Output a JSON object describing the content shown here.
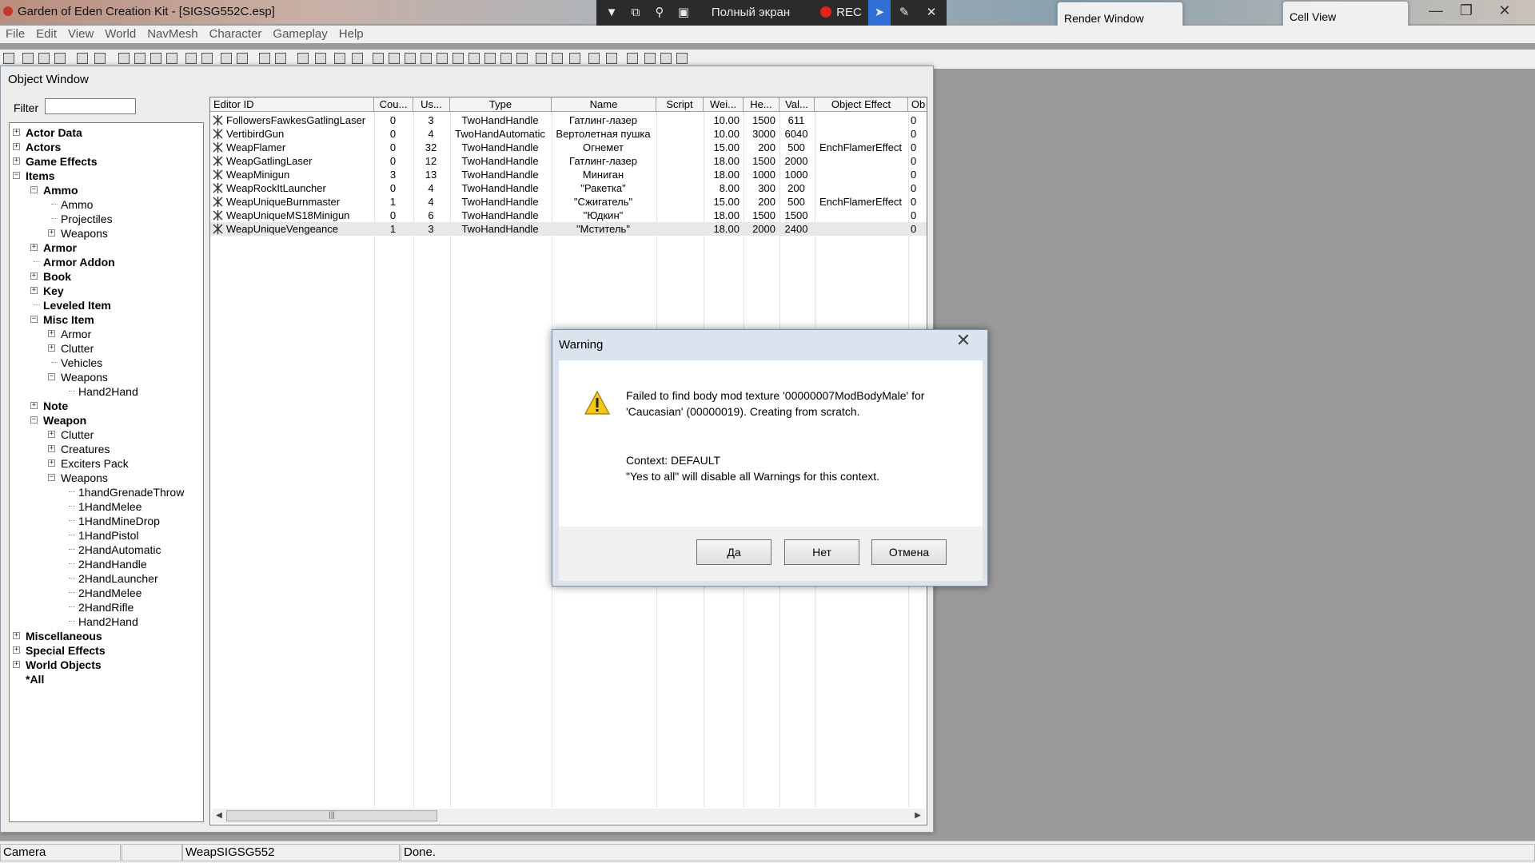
{
  "app": {
    "title": "Garden of Eden Creation Kit - [SIGSG552C.esp]"
  },
  "recorder": {
    "fullscreen_label": "Полный экран",
    "rec_label": "REC"
  },
  "floating": {
    "render_window": "Render Window",
    "cell_view": "Cell View"
  },
  "menu": [
    "File",
    "Edit",
    "View",
    "World",
    "NavMesh",
    "Character",
    "Gameplay",
    "Help"
  ],
  "object_window": {
    "title": "Object Window",
    "filter_label": "Filter",
    "filter_value": ""
  },
  "tree": [
    {
      "label": "Actor Data",
      "level": 0,
      "bold": true,
      "exp": "+"
    },
    {
      "label": "Actors",
      "level": 0,
      "bold": true,
      "exp": "+"
    },
    {
      "label": "Game Effects",
      "level": 0,
      "bold": true,
      "exp": "+"
    },
    {
      "label": "Items",
      "level": 0,
      "bold": true,
      "exp": "-"
    },
    {
      "label": "Ammo",
      "level": 1,
      "bold": true,
      "exp": "-"
    },
    {
      "label": "Ammo",
      "level": 2,
      "bold": false,
      "exp": ""
    },
    {
      "label": "Projectiles",
      "level": 2,
      "bold": false,
      "exp": ""
    },
    {
      "label": "Weapons",
      "level": 2,
      "bold": false,
      "exp": "+"
    },
    {
      "label": "Armor",
      "level": 1,
      "bold": true,
      "exp": "+"
    },
    {
      "label": "Armor Addon",
      "level": 1,
      "bold": true,
      "exp": ""
    },
    {
      "label": "Book",
      "level": 1,
      "bold": true,
      "exp": "+"
    },
    {
      "label": "Key",
      "level": 1,
      "bold": true,
      "exp": "+"
    },
    {
      "label": "Leveled Item",
      "level": 1,
      "bold": true,
      "exp": ""
    },
    {
      "label": "Misc Item",
      "level": 1,
      "bold": true,
      "exp": "-"
    },
    {
      "label": "Armor",
      "level": 2,
      "bold": false,
      "exp": "+"
    },
    {
      "label": "Clutter",
      "level": 2,
      "bold": false,
      "exp": "+"
    },
    {
      "label": "Vehicles",
      "level": 2,
      "bold": false,
      "exp": ""
    },
    {
      "label": "Weapons",
      "level": 2,
      "bold": false,
      "exp": "-"
    },
    {
      "label": "Hand2Hand",
      "level": 3,
      "bold": false,
      "exp": ""
    },
    {
      "label": "Note",
      "level": 1,
      "bold": true,
      "exp": "+"
    },
    {
      "label": "Weapon",
      "level": 1,
      "bold": true,
      "exp": "-"
    },
    {
      "label": "Clutter",
      "level": 2,
      "bold": false,
      "exp": "+"
    },
    {
      "label": "Creatures",
      "level": 2,
      "bold": false,
      "exp": "+"
    },
    {
      "label": "Exciters Pack",
      "level": 2,
      "bold": false,
      "exp": "+"
    },
    {
      "label": "Weapons",
      "level": 2,
      "bold": false,
      "exp": "-"
    },
    {
      "label": "1handGrenadeThrow",
      "level": 3,
      "bold": false,
      "exp": ""
    },
    {
      "label": "1HandMelee",
      "level": 3,
      "bold": false,
      "exp": ""
    },
    {
      "label": "1HandMineDrop",
      "level": 3,
      "bold": false,
      "exp": ""
    },
    {
      "label": "1HandPistol",
      "level": 3,
      "bold": false,
      "exp": ""
    },
    {
      "label": "2HandAutomatic",
      "level": 3,
      "bold": false,
      "exp": ""
    },
    {
      "label": "2HandHandle",
      "level": 3,
      "bold": false,
      "exp": ""
    },
    {
      "label": "2HandLauncher",
      "level": 3,
      "bold": false,
      "exp": ""
    },
    {
      "label": "2HandMelee",
      "level": 3,
      "bold": false,
      "exp": ""
    },
    {
      "label": "2HandRifle",
      "level": 3,
      "bold": false,
      "exp": ""
    },
    {
      "label": "Hand2Hand",
      "level": 3,
      "bold": false,
      "exp": ""
    },
    {
      "label": "Miscellaneous",
      "level": 0,
      "bold": true,
      "exp": "+"
    },
    {
      "label": "Special Effects",
      "level": 0,
      "bold": true,
      "exp": "+"
    },
    {
      "label": "World Objects",
      "level": 0,
      "bold": true,
      "exp": "+"
    },
    {
      "label": "*All",
      "level": 0,
      "bold": true,
      "exp": ""
    }
  ],
  "columns": [
    "Editor ID",
    "Cou...",
    "Us...",
    "Type",
    "Name",
    "Script",
    "Wei...",
    "He...",
    "Val...",
    "Object Effect",
    "Ob"
  ],
  "rows": [
    [
      "FollowersFawkesGatlingLaser",
      "0",
      "3",
      "TwoHandHandle",
      "Гатлинг-лазер",
      "",
      "10.00",
      "1500",
      "611",
      "",
      "0"
    ],
    [
      "VertibirdGun",
      "0",
      "4",
      "TwoHandAutomatic",
      "Вертолетная пушка",
      "",
      "10.00",
      "3000",
      "6040",
      "",
      "0"
    ],
    [
      "WeapFlamer",
      "0",
      "32",
      "TwoHandHandle",
      "Огнемет",
      "",
      "15.00",
      "200",
      "500",
      "EnchFlamerEffect",
      "0"
    ],
    [
      "WeapGatlingLaser",
      "0",
      "12",
      "TwoHandHandle",
      "Гатлинг-лазер",
      "",
      "18.00",
      "1500",
      "2000",
      "",
      "0"
    ],
    [
      "WeapMinigun",
      "3",
      "13",
      "TwoHandHandle",
      "Миниган",
      "",
      "18.00",
      "1000",
      "1000",
      "",
      "0"
    ],
    [
      "WeapRockItLauncher",
      "0",
      "4",
      "TwoHandHandle",
      "\"Ракетка\"",
      "",
      "8.00",
      "300",
      "200",
      "",
      "0"
    ],
    [
      "WeapUniqueBurnmaster",
      "1",
      "4",
      "TwoHandHandle",
      "\"Сжигатель\"",
      "",
      "15.00",
      "200",
      "500",
      "EnchFlamerEffect",
      "0"
    ],
    [
      "WeapUniqueMS18Minigun",
      "0",
      "6",
      "TwoHandHandle",
      "\"Юдкин\"",
      "",
      "18.00",
      "1500",
      "1500",
      "",
      "0"
    ],
    [
      "WeapUniqueVengeance",
      "1",
      "3",
      "TwoHandHandle",
      "\"Мститель\"",
      "",
      "18.00",
      "2000",
      "2400",
      "",
      "0"
    ]
  ],
  "dialog": {
    "title": "Warning",
    "message_line1": "Failed to find body mod texture '00000007ModBodyMale' for",
    "message_line2": "'Caucasian' (00000019). Creating from scratch.",
    "context_line1": "Context: DEFAULT",
    "context_line2": "\"Yes to all\" will disable all Warnings for this context.",
    "btn_yes": "Да",
    "btn_no": "Нет",
    "btn_cancel": "Отмена"
  },
  "status": {
    "camera": "Camera",
    "blank": "",
    "ref": "WeapSIGSG552",
    "state": "Done."
  },
  "colors": {
    "selected_row": "#e8e8e8",
    "warning_yellow": "#f5c518",
    "rec_red": "#e0231b"
  }
}
